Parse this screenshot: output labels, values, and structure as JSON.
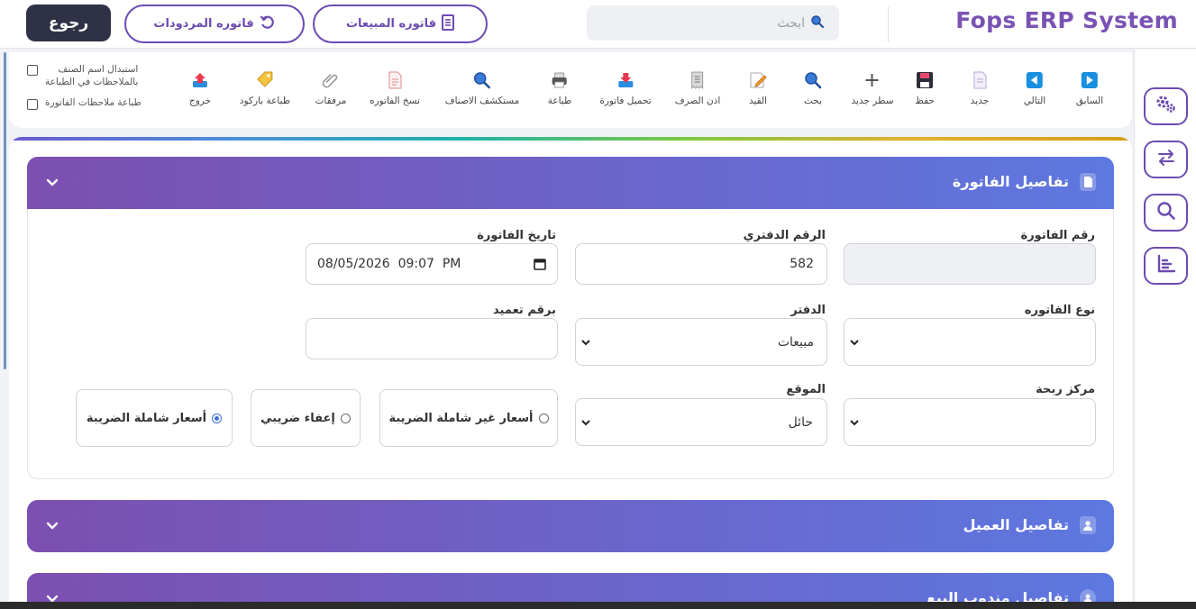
{
  "header": {
    "brand": "Fops ERP System",
    "search_placeholder": "ابحث",
    "sales_invoice_label": "فاتوره المبيعات",
    "returns_invoice_label": "فاتوره المردودات",
    "back_label": "رجوع"
  },
  "toolbar": {
    "items": [
      {
        "label": "السابق",
        "icon": "play-right-icon"
      },
      {
        "label": "التالي",
        "icon": "play-left-icon"
      },
      {
        "label": "جديد",
        "icon": "new-document-icon"
      },
      {
        "label": "حفظ",
        "icon": "floppy-disk-icon"
      },
      {
        "label": "سطر جديد",
        "icon": "plus-icon"
      },
      {
        "label": "بحث",
        "icon": "search-icon"
      },
      {
        "label": "القيد",
        "icon": "journal-edit-icon"
      },
      {
        "label": "اذن الصرف",
        "icon": "receipt-icon"
      },
      {
        "label": "تحميل فاتورة",
        "icon": "download-icon"
      },
      {
        "label": "طباعة",
        "icon": "printer-icon"
      },
      {
        "label": "مستكشف الاصناف",
        "icon": "magnifier-icon"
      },
      {
        "label": "نسخ الفاتوره",
        "icon": "copy-document-icon"
      },
      {
        "label": "مرفقات",
        "icon": "paperclip-icon"
      },
      {
        "label": "طباعة باركود",
        "icon": "tag-icon"
      },
      {
        "label": "خروج",
        "icon": "upload-exit-icon"
      }
    ],
    "checkbox_1_label_line1": "استبدال اسم الصنف",
    "checkbox_1_label_line2": "بالملاحظات في الطباعة",
    "checkbox_2_label": "طباعة ملاحظات الفاتورة"
  },
  "invoice_section": {
    "title": "تفاصيل الفاتورة",
    "invoice_number_label": "رقم الفاتورة",
    "invoice_number_value": "",
    "ledger_number_label": "الرقم الدفتري",
    "ledger_number_value": "582",
    "invoice_date_label": "تاريخ الفاتورة",
    "invoice_date_value": "08/05/2026  09:07  PM",
    "invoice_type_label": "نوع الفاتوره",
    "invoice_type_value": "",
    "book_label": "الدفتر",
    "book_value": "مبيعات",
    "approval_number_label": "برقم تعميد",
    "approval_number_value": "",
    "profit_center_label": "مركز ربحة",
    "profit_center_value": "",
    "location_label": "الموقع",
    "location_value": "حائل",
    "radio_excluding_tax": "أسعار غير شاملة الضريبة",
    "radio_tax_exempt": "إعفاء ضريبي",
    "radio_including_tax": "أسعار شاملة الضريبة",
    "selected_pricing": "أسعار شاملة الضريبة"
  },
  "customer_section": {
    "title": "تفاصيل العميل"
  },
  "salesrep_section": {
    "title": "تفاصيل مندوب البيع"
  },
  "colors": {
    "accent": "#6c4bb1",
    "dark_button": "#2f3147",
    "gradient_start": "#7c4fb0",
    "gradient_end": "#5d78e0"
  }
}
